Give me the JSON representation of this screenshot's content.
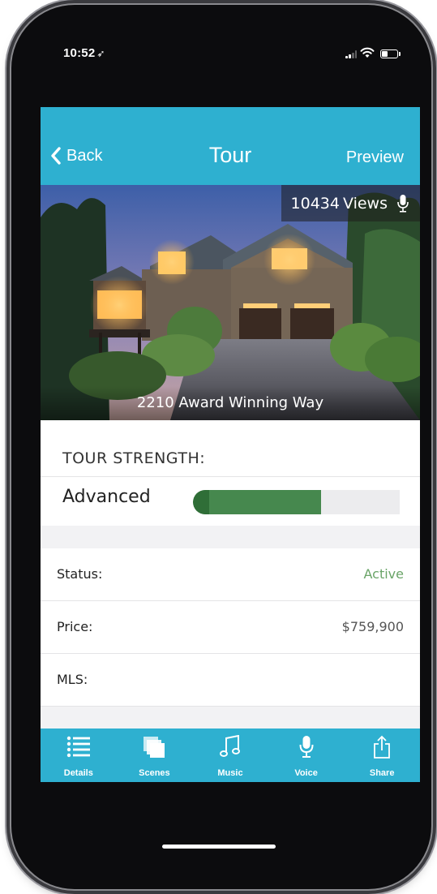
{
  "status_bar": {
    "time": "10:52",
    "location_glyph": "➶"
  },
  "nav": {
    "back_label": "Back",
    "title": "Tour",
    "preview_label": "Preview"
  },
  "listing": {
    "views_count": "10434",
    "views_label": "Views",
    "address": "2210 Award Winning Way"
  },
  "strength": {
    "title": "TOUR STRENGTH:",
    "level": "Advanced",
    "progress_fraction": 0.62
  },
  "details": [
    {
      "label": "Status:",
      "value": "Active"
    },
    {
      "label": "Price:",
      "value": "$759,900"
    },
    {
      "label": "MLS:",
      "value": ""
    }
  ],
  "tabs": [
    {
      "label": "Details",
      "icon": "list-icon"
    },
    {
      "label": "Scenes",
      "icon": "stack-icon"
    },
    {
      "label": "Music",
      "icon": "music-note-icon"
    },
    {
      "label": "Voice",
      "icon": "microphone-icon"
    },
    {
      "label": "Share",
      "icon": "share-icon"
    }
  ],
  "colors": {
    "accent": "#2eb0d0",
    "progress": "#46884e",
    "status_active": "#6aa468"
  }
}
